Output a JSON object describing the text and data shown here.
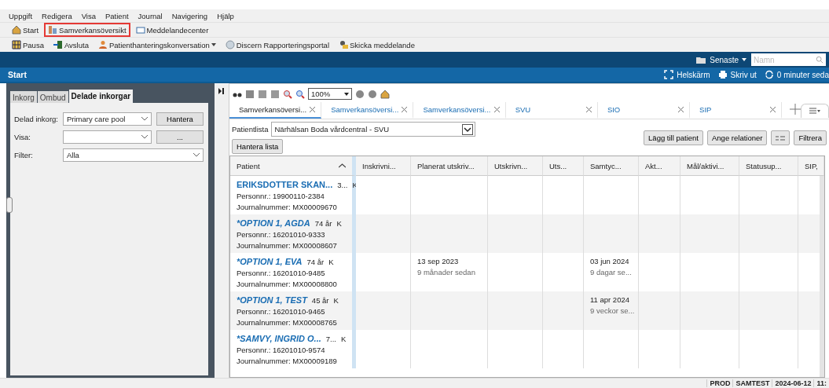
{
  "menu": [
    "Uppgift",
    "Redigera",
    "Visa",
    "Patient",
    "Journal",
    "Navigering",
    "Hjälp"
  ],
  "toolbar_1": [
    {
      "label": "Start",
      "kind": "home",
      "highlighted": false
    },
    {
      "label": "Samverkansöversikt",
      "kind": "overview",
      "highlighted": true
    },
    {
      "label": "Meddelandecenter",
      "kind": "mail",
      "highlighted": false
    }
  ],
  "toolbar_2": [
    {
      "label": "Pausa",
      "kind": "pause",
      "dropdown": false
    },
    {
      "label": "Avsluta",
      "kind": "exit",
      "dropdown": false
    },
    {
      "label": "Patienthanteringskonversation",
      "kind": "person",
      "dropdown": true
    },
    {
      "label": "Discern Rapporteringsportal",
      "kind": "portal",
      "dropdown": false
    },
    {
      "label": "Skicka meddelande",
      "kind": "send",
      "dropdown": false
    }
  ],
  "header": {
    "recent": "Senaste",
    "search": {
      "placeholder": "Namn"
    }
  },
  "start_bar": {
    "title": "Start",
    "actions": [
      {
        "label": "Helskärm",
        "kind": "fullscreen"
      },
      {
        "label": "Skriv ut",
        "kind": "print"
      },
      {
        "label": "0 minuter seda",
        "kind": "refresh"
      }
    ]
  },
  "left_panel": {
    "tabs": [
      {
        "label": "Inkorg",
        "selected": false
      },
      {
        "label": "Ombud",
        "selected": false
      },
      {
        "label": "Delade inkorgar",
        "selected": true
      }
    ],
    "fields": [
      {
        "label": "Delad inkorg:",
        "value": "Primary care pool",
        "button": "Hantera"
      },
      {
        "label": "Visa:",
        "button": "..."
      },
      {
        "label": "Filter:",
        "value": "Alla"
      }
    ]
  },
  "zoom": "100%",
  "doc_tabs": [
    {
      "label": "Samverkansöversi...",
      "selected": true
    },
    {
      "label": "Samverkansöversi...",
      "selected": false
    },
    {
      "label": "Samverkansöversi...",
      "selected": false
    },
    {
      "label": "SVU",
      "selected": false
    },
    {
      "label": "SIO",
      "selected": false
    },
    {
      "label": "SIP",
      "selected": false
    }
  ],
  "patient_list": {
    "label": "Patientlista",
    "value": "Närhälsan Boda vårdcentral - SVU",
    "manage": "Hantera lista",
    "buttons": [
      "Lägg till patient",
      "Ange relationer"
    ],
    "filter": "Filtrera"
  },
  "table": {
    "patient_header": "Patient",
    "columns": [
      "Inskrivni...",
      "Planerat utskriv...",
      "Utskrivn...",
      "Uts...",
      "Samtyc...",
      "Akt...",
      "Mål/aktivi...",
      "Statusup...",
      "SIP,"
    ],
    "rows": [
      {
        "name": "ERIKSDOTTER SKAN...",
        "age": "3...",
        "sex": "K",
        "personnr": "Personnr.: 19900110-2384",
        "journal": "Journalnummer: MX00009670",
        "cells": [
          "",
          "",
          "",
          "",
          "",
          "",
          "",
          "",
          ""
        ]
      },
      {
        "name": "*OPTION 1, AGDA",
        "age": "74 år",
        "sex": "K",
        "personnr": "Personnr.: 16201010-9333",
        "journal": "Journalnummer: MX00008607",
        "cells": [
          "",
          "",
          "",
          "",
          "",
          "",
          "",
          "",
          ""
        ]
      },
      {
        "name": "*OPTION 1, EVA",
        "age": "74 år",
        "sex": "K",
        "personnr": "Personnr.: 16201010-9485",
        "journal": "Journalnummer: MX00008800",
        "cells": [
          "",
          {
            "date": "13 sep 2023",
            "ago": "9 månader sedan"
          },
          "",
          "",
          {
            "date": "03 jun 2024",
            "ago": "9 dagar se..."
          },
          "",
          "",
          "",
          ""
        ]
      },
      {
        "name": "*OPTION 1, TEST",
        "age": "45 år",
        "sex": "K",
        "personnr": "Personnr.: 16201010-9465",
        "journal": "Journalnummer: MX00008765",
        "cells": [
          "",
          "",
          "",
          "",
          {
            "date": "11 apr 2024",
            "ago": "9 veckor se..."
          },
          "",
          "",
          "",
          ""
        ]
      },
      {
        "name": "*SAMVY, INGRID O...",
        "age": "7...",
        "sex": "K",
        "personnr": "Personnr.: 16201010-9574",
        "journal": "Journalnummer: MX00009189",
        "cells": [
          "",
          "",
          "",
          "",
          "",
          "",
          "",
          "",
          ""
        ]
      }
    ]
  },
  "status_bar": [
    "PROD",
    "SAMTEST",
    "2024-06-12",
    "11:"
  ]
}
